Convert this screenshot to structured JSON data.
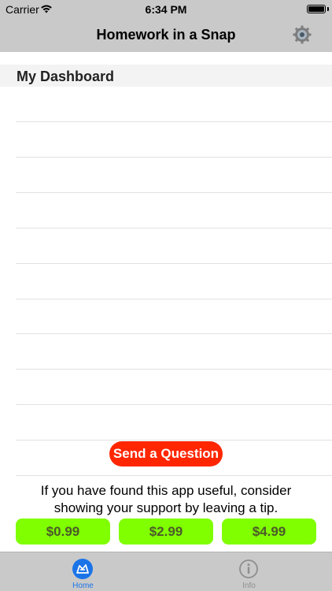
{
  "status_bar": {
    "carrier": "Carrier",
    "time": "6:34 PM"
  },
  "nav": {
    "title": "Homework in a Snap",
    "settings_icon": "gear-icon"
  },
  "dashboard": {
    "section_title": "My Dashboard",
    "row_count": 11
  },
  "actions": {
    "send_label": "Send a Question",
    "send_color": "#ff2600"
  },
  "support": {
    "message": "If you have found this app useful, consider showing your support by leaving a tip.",
    "tips": [
      "$0.99",
      "$2.99",
      "$4.99"
    ],
    "tip_color": "#80ff00"
  },
  "tab_bar": {
    "tabs": [
      {
        "label": "Home",
        "icon": "home-icon",
        "active": true
      },
      {
        "label": "Info",
        "icon": "info-icon",
        "active": false
      }
    ],
    "active_color": "#1a74e8"
  }
}
